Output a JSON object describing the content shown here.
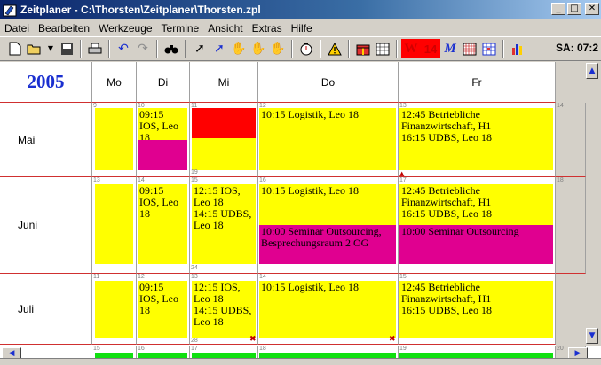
{
  "window": {
    "title": "Zeitplaner - C:\\Thorsten\\Zeitplaner\\Thorsten.zpl",
    "minimize": "_",
    "maximize": "□",
    "close": "✕"
  },
  "menu": [
    "Datei",
    "Bearbeiten",
    "Werkzeuge",
    "Termine",
    "Ansicht",
    "Extras",
    "Hilfe"
  ],
  "toolbar": {
    "clock": "SA: 07:2",
    "w_label": "W",
    "fourteen_label": "14",
    "m_label": "M"
  },
  "calendar": {
    "year": "2005",
    "days": [
      "Mo",
      "Di",
      "Mi",
      "Do",
      "Fr"
    ],
    "months": [
      "Mai",
      "Juni",
      "Juli"
    ],
    "rows": [
      {
        "nums": [
          "9",
          "10",
          "11",
          "12",
          "13",
          "14"
        ],
        "bottom_nums": [
          "",
          "",
          "19",
          "",
          "",
          ""
        ],
        "events": {
          "di": "09:15 IOS, Leo 18",
          "do": "10:15 Logistik, Leo 18",
          "fr": "12:45 Betriebliche Finanzwirtschaft, H1\n16:15 UDBS, Leo 18"
        }
      },
      {
        "nums": [
          "13",
          "14",
          "15",
          "16",
          "17",
          "18"
        ],
        "bottom_nums": [
          "",
          "",
          "24",
          "",
          "",
          ""
        ],
        "events": {
          "di": "09:15 IOS, Leo 18",
          "mi": "12:15 IOS, Leo 18\n14:15 UDBS, Leo 18",
          "do": "10:15 Logistik, Leo 18",
          "do2": "10:00 Seminar Outsourcing, Besprechungsraum 2 OG",
          "fr": "12:45 Betriebliche Finanzwirtschaft, H1\n16:15 UDBS, Leo 18",
          "fr2": "10:00 Seminar Outsourcing"
        }
      },
      {
        "nums": [
          "11",
          "12",
          "13",
          "14",
          "15",
          ""
        ],
        "bottom_nums": [
          "",
          "",
          "28",
          "",
          "",
          ""
        ],
        "events": {
          "di": "09:15 IOS, Leo 18",
          "mi": "12:15 IOS, Leo 18\n14:15 UDBS, Leo 18",
          "do": "10:15 Logistik, Leo 18",
          "fr": "12:45 Betriebliche Finanzwirtschaft, H1\n16:15 UDBS, Leo 18"
        }
      },
      {
        "nums": [
          "15",
          "16",
          "17",
          "18",
          "19",
          "20"
        ]
      }
    ]
  },
  "colors": {
    "event": "#ffff00",
    "seminar": "#e00090",
    "blocked": "#ff0000",
    "year": "#1a2fd0",
    "row_line": "#d03030"
  }
}
